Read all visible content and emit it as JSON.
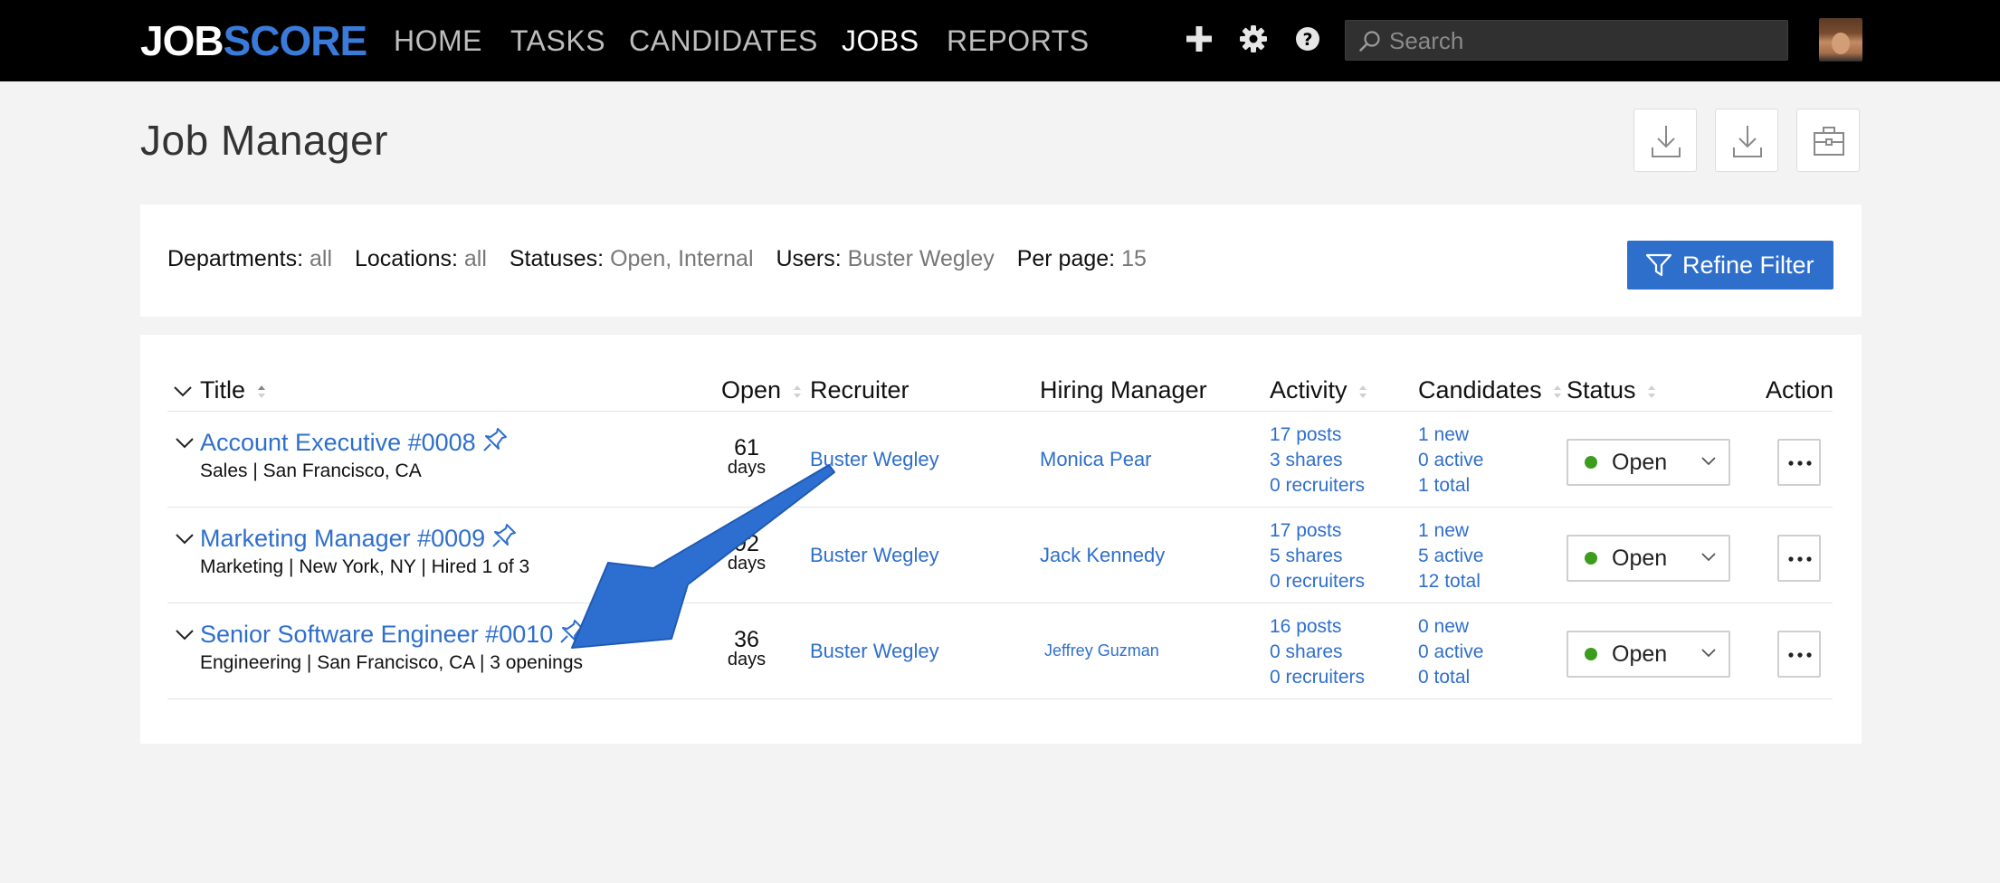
{
  "brand": {
    "logo_part1": "JOB",
    "logo_part2": "SCORE"
  },
  "nav": {
    "home": "HOME",
    "tasks": "TASKS",
    "candidates": "CANDIDATES",
    "jobs": "JOBS",
    "reports": "REPORTS"
  },
  "search": {
    "placeholder": "Search"
  },
  "page": {
    "title": "Job Manager"
  },
  "filters": {
    "departments_label": "Departments:",
    "departments_value": "all",
    "locations_label": "Locations:",
    "locations_value": "all",
    "statuses_label": "Statuses:",
    "statuses_value": "Open, Internal",
    "users_label": "Users:",
    "users_value": "Buster Wegley",
    "perpage_label": "Per page:",
    "perpage_value": "15",
    "refine_label": "Refine Filter"
  },
  "table": {
    "headers": {
      "title": "Title",
      "open": "Open",
      "recruiter": "Recruiter",
      "hiring_manager": "Hiring Manager",
      "activity": "Activity",
      "candidates": "Candidates",
      "status": "Status",
      "action": "Action"
    },
    "rows": [
      {
        "title": "Account Executive #0008",
        "subtitle": "Sales | San Francisco, CA",
        "open_days": "61",
        "days_label": "days",
        "recruiter": "Buster Wegley",
        "hiring_manager": "Monica Pear",
        "activity": {
          "posts": "17 posts",
          "shares": "3 shares",
          "recruiters": "0 recruiters"
        },
        "candidates": {
          "new": "1 new",
          "active": "0 active",
          "total": "1 total"
        },
        "status": "Open"
      },
      {
        "title": "Marketing Manager #0009",
        "subtitle": "Marketing | New York, NY | Hired 1 of 3",
        "open_days": "92",
        "days_label": "days",
        "recruiter": "Buster Wegley",
        "hiring_manager": "Jack Kennedy",
        "activity": {
          "posts": "17 posts",
          "shares": "5 shares",
          "recruiters": "0 recruiters"
        },
        "candidates": {
          "new": "1 new",
          "active": "5 active",
          "total": "12 total"
        },
        "status": "Open"
      },
      {
        "title": "Senior Software Engineer #0010",
        "subtitle": "Engineering | San Francisco, CA | 3 openings",
        "open_days": "36",
        "days_label": "days",
        "recruiter": "Buster Wegley",
        "hiring_manager": "Jeffrey Guzman",
        "activity": {
          "posts": "16 posts",
          "shares": "0 shares",
          "recruiters": "0 recruiters"
        },
        "candidates": {
          "new": "0 new",
          "active": "0 active",
          "total": "0 total"
        },
        "status": "Open"
      }
    ]
  },
  "colors": {
    "accent": "#2f6fcc",
    "status_open": "#3c9c1d",
    "annotation_arrow": "#2d6fd0"
  }
}
